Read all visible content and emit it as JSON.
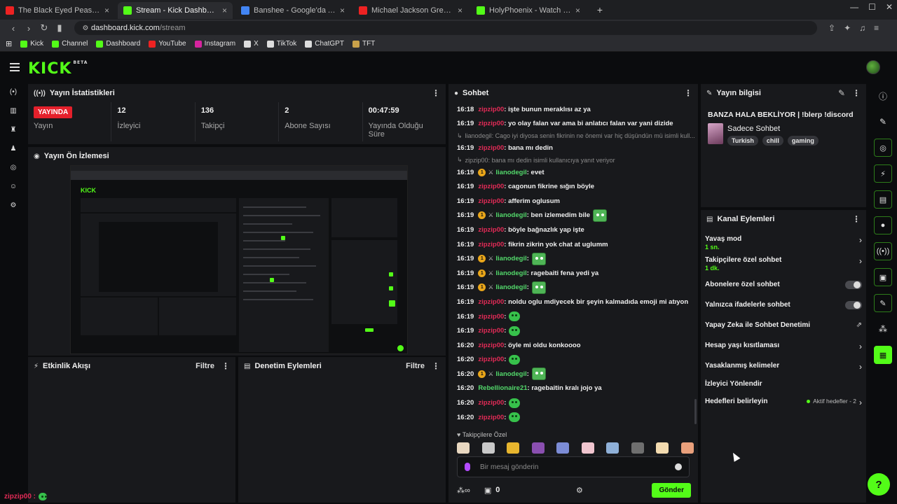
{
  "browser": {
    "tabs": [
      {
        "title": "The Black Eyed Peas - I Gotta Feeling",
        "color": "#e22"
      },
      {
        "title": "Stream - Kick Dashboard",
        "color": "#53fc18"
      },
      {
        "title": "Banshee - Google'da Ara",
        "color": "#4285f4"
      },
      {
        "title": "Michael Jackson Greatest Hits Fu",
        "color": "#e22"
      },
      {
        "title": "HolyPhoenix - Watch the VOD on Ki",
        "color": "#53fc18"
      }
    ],
    "url_host": "dashboard.kick.com",
    "url_path": "/stream",
    "bookmarks": [
      {
        "label": "Kick",
        "color": "#53fc18"
      },
      {
        "label": "Channel",
        "color": "#53fc18"
      },
      {
        "label": "Dashboard",
        "color": "#53fc18"
      },
      {
        "label": "YouTube",
        "color": "#e22"
      },
      {
        "label": "Instagram",
        "color": "#d6249f"
      },
      {
        "label": "X",
        "color": "#ddd"
      },
      {
        "label": "TikTok",
        "color": "#ddd"
      },
      {
        "label": "ChatGPT",
        "color": "#ddd"
      },
      {
        "label": "TFT",
        "color": "#c9a14a"
      }
    ]
  },
  "kick": {
    "logo": "KICK",
    "logo_sup": "BETA",
    "accent": "#53fc18"
  },
  "stats_panel": {
    "title": "Yayın İstatistikleri",
    "live_badge": "YAYINDA",
    "items": [
      {
        "value": "",
        "label": "Yayın"
      },
      {
        "value": "12",
        "label": "İzleyici"
      },
      {
        "value": "136",
        "label": "Takipçi"
      },
      {
        "value": "2",
        "label": "Abone Sayısı"
      },
      {
        "value": "00:47:59",
        "label": "Yayında Olduğu Süre"
      }
    ]
  },
  "preview_panel": {
    "title": "Yayın Ön İzlemesi"
  },
  "activity_panel": {
    "title": "Etkinlik Akışı",
    "filter": "Filtre"
  },
  "moderation_panel": {
    "title": "Denetim Eylemleri",
    "filter": "Filtre"
  },
  "chat": {
    "title": "Sohbet",
    "messages": [
      {
        "kind": "msg",
        "time": "16:18",
        "user": "zipzip00",
        "user_color": "#e32b57",
        "text": ": işte bunun meraklısı az ya"
      },
      {
        "kind": "msg",
        "time": "16:19",
        "user": "zipzip00",
        "user_color": "#e32b57",
        "text": ": yo olay falan var ama bi anlatıcı falan var yani dizide"
      },
      {
        "kind": "reply",
        "text": "lianodegil: Cago iyi diyosa senin fikrinin ne önemi var hiç düşündün mü isimli kull..."
      },
      {
        "kind": "msg",
        "time": "16:19",
        "user": "zipzip00",
        "user_color": "#e32b57",
        "text": ": bana mı dedin"
      },
      {
        "kind": "reply",
        "text": "zipzip00: bana mı dedin isimli kullanıcıya yanıt veriyor"
      },
      {
        "kind": "msg",
        "time": "16:19",
        "user": "lianodegil",
        "user_color": "#53d96b",
        "badges": true,
        "text": ": evet"
      },
      {
        "kind": "msg",
        "time": "16:19",
        "user": "zipzip00",
        "user_color": "#e32b57",
        "text": ": cagonun fikrine sığın böyle"
      },
      {
        "kind": "msg",
        "time": "16:19",
        "user": "zipzip00",
        "user_color": "#e32b57",
        "text": ": afferim oglusum"
      },
      {
        "kind": "msg",
        "time": "16:19",
        "user": "lianodegil",
        "user_color": "#53d96b",
        "badges": true,
        "text": ": ben izlemedim bile",
        "emote": "big"
      },
      {
        "kind": "msg",
        "time": "16:19",
        "user": "zipzip00",
        "user_color": "#e32b57",
        "text": ": böyle bağnazlık yap işte"
      },
      {
        "kind": "msg",
        "time": "16:19",
        "user": "zipzip00",
        "user_color": "#e32b57",
        "text": ": fikrin zikrin yok chat at uglumm"
      },
      {
        "kind": "msg",
        "time": "16:19",
        "user": "lianodegil",
        "user_color": "#53d96b",
        "badges": true,
        "text": ":",
        "emote": "big"
      },
      {
        "kind": "msg",
        "time": "16:19",
        "user": "lianodegil",
        "user_color": "#53d96b",
        "badges": true,
        "text": ": ragebaiti fena yedi ya"
      },
      {
        "kind": "msg",
        "time": "16:19",
        "user": "lianodegil",
        "user_color": "#53d96b",
        "badges": true,
        "text": ":",
        "emote": "big"
      },
      {
        "kind": "msg",
        "time": "16:19",
        "user": "zipzip00",
        "user_color": "#e32b57",
        "text": ": noldu oglu mdiyecek bir şeyin kalmadıda emoji mi atıyon"
      },
      {
        "kind": "msg",
        "time": "16:19",
        "user": "zipzip00",
        "user_color": "#e32b57",
        "text": ":",
        "emote": "green"
      },
      {
        "kind": "msg",
        "time": "16:19",
        "user": "zipzip00",
        "user_color": "#e32b57",
        "text": ":",
        "emote": "green"
      },
      {
        "kind": "msg",
        "time": "16:20",
        "user": "zipzip00",
        "user_color": "#e32b57",
        "text": ": öyle mi oldu konkoooo"
      },
      {
        "kind": "msg",
        "time": "16:20",
        "user": "zipzip00",
        "user_color": "#e32b57",
        "text": ":",
        "emote": "green"
      },
      {
        "kind": "msg",
        "time": "16:20",
        "user": "lianodegil",
        "user_color": "#53d96b",
        "badges": true,
        "text": ":",
        "emote": "big"
      },
      {
        "kind": "msg",
        "time": "16:20",
        "user": "Rebellionaire21",
        "user_color": "#53d96b",
        "text": ": ragebaitin kralı jojo ya"
      },
      {
        "kind": "msg",
        "time": "16:20",
        "user": "zipzip00",
        "user_color": "#e32b57",
        "text": ":",
        "emote": "green"
      },
      {
        "kind": "msg",
        "time": "16:20",
        "user": "zipzip00",
        "user_color": "#e32b57",
        "text": ":",
        "emote": "green"
      }
    ],
    "followers_only": "Takipçilere Özel",
    "input_placeholder": "Bir mesaj gönderin",
    "footer_count": "0",
    "send_label": "Gönder"
  },
  "stream_info": {
    "title": "Yayın bilgisi",
    "stream_title": "BANZA HALA BEKLİYOR | !blerp !discord",
    "category": "Sadece Sohbet",
    "tags": [
      "Turkish",
      "chill",
      "gaming"
    ]
  },
  "channel_actions": {
    "title": "Kanal Eylemleri",
    "items": [
      {
        "label": "Yavaş mod",
        "sub": "1 sn.",
        "control": "chevron"
      },
      {
        "label": "Takipçilere özel sohbet",
        "sub": "1 dk.",
        "control": "chevron"
      },
      {
        "label": "Abonelere özel sohbet",
        "control": "toggle"
      },
      {
        "label": "Yalnızca ifadelerle sohbet",
        "control": "toggle"
      },
      {
        "label": "Yapay Zeka ile Sohbet Denetimi",
        "control": "external"
      },
      {
        "label": "Hesap yaşı kısıtlaması",
        "control": "chevron"
      },
      {
        "label": "Yasaklanmış kelimeler",
        "control": "chevron"
      },
      {
        "label": "İzleyici Yönlendir",
        "control": "none"
      },
      {
        "label": "Hedefleri belirleyin",
        "control": "chevron",
        "aux": "Aktif hedefler - 2"
      }
    ]
  },
  "bottom_user": "zipzip00 :"
}
